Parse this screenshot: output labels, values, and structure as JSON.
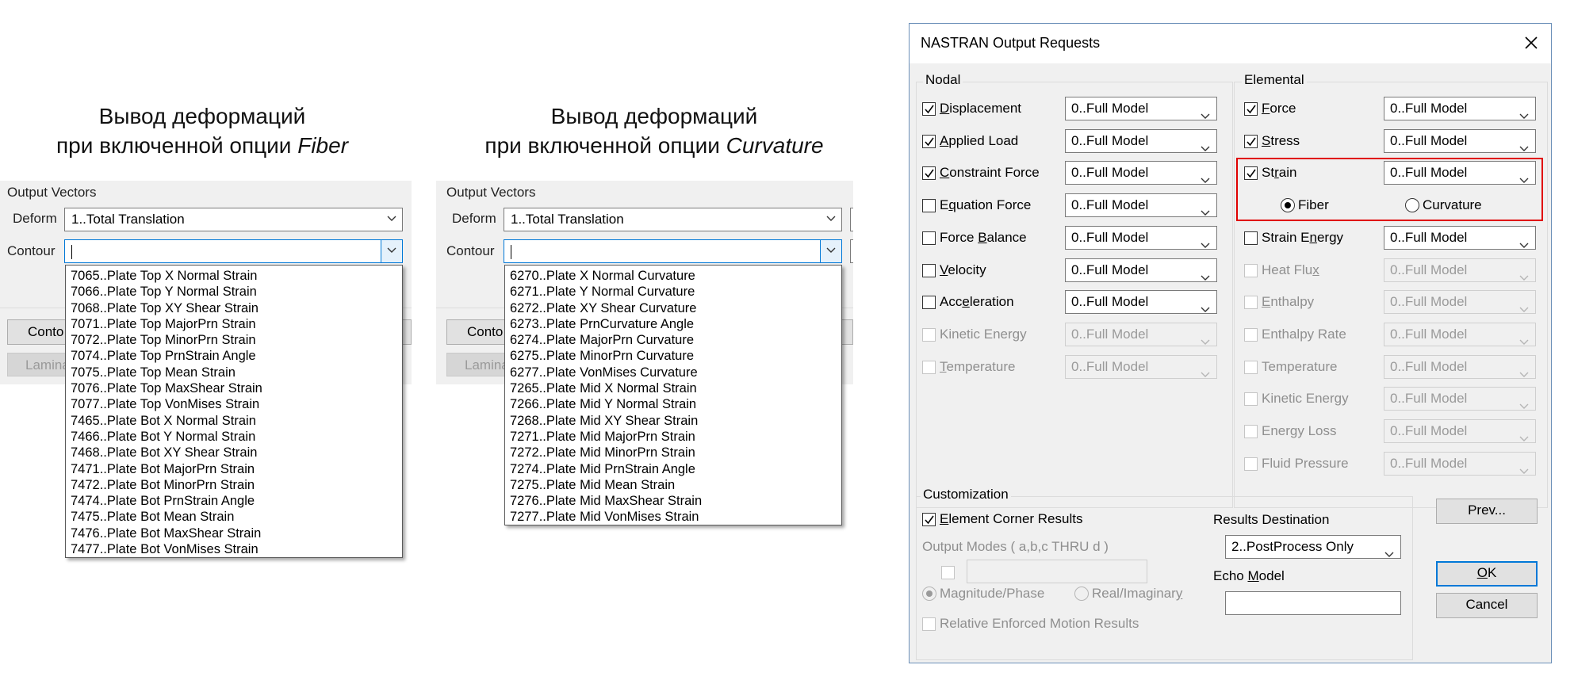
{
  "captions": {
    "fiber": {
      "line1": "Вывод деформаций",
      "line2_prefix": "при включенной опции ",
      "line2_em": "Fiber"
    },
    "curvature": {
      "line1": "Вывод деформаций",
      "line2_prefix": "при включенной опции ",
      "line2_em": "Curvature"
    }
  },
  "left_panel": {
    "group_label": "Output Vectors",
    "deform_label": "Deform",
    "deform_value": "1..Total Translation",
    "contour_label": "Contour",
    "contour_value": "",
    "contour_button": "Conto",
    "laminate_button": "Lamina",
    "list": [
      "7065..Plate Top X Normal Strain",
      "7066..Plate Top Y Normal Strain",
      "7068..Plate Top XY Shear Strain",
      "7071..Plate Top MajorPrn Strain",
      "7072..Plate Top MinorPrn Strain",
      "7074..Plate Top PrnStrain Angle",
      "7075..Plate Top Mean Strain",
      "7076..Plate Top MaxShear Strain",
      "7077..Plate Top VonMises Strain",
      "7465..Plate Bot X Normal Strain",
      "7466..Plate Bot Y Normal Strain",
      "7468..Plate Bot XY Shear Strain",
      "7471..Plate Bot MajorPrn Strain",
      "7472..Plate Bot MinorPrn Strain",
      "7474..Plate Bot PrnStrain Angle",
      "7475..Plate Bot Mean Strain",
      "7476..Plate Bot MaxShear Strain",
      "7477..Plate Bot VonMises Strain"
    ]
  },
  "middle_panel": {
    "group_label": "Output Vectors",
    "deform_label": "Deform",
    "deform_value": "1..Total Translation",
    "contour_label": "Contour",
    "contour_value": "",
    "contour_button": "Conto",
    "laminate_button": "Lamina",
    "list": [
      "6270..Plate X Normal Curvature",
      "6271..Plate Y Normal Curvature",
      "6272..Plate XY Shear Curvature",
      "6273..Plate PrnCurvature Angle",
      "6274..Plate MajorPrn Curvature",
      "6275..Plate MinorPrn Curvature",
      "6277..Plate VonMises Curvature",
      "7265..Plate Mid X Normal Strain",
      "7266..Plate Mid Y Normal Strain",
      "7268..Plate Mid XY Shear Strain",
      "7271..Plate Mid MajorPrn Strain",
      "7272..Plate Mid MinorPrn Strain",
      "7274..Plate Mid PrnStrain Angle",
      "7275..Plate Mid Mean Strain",
      "7276..Plate Mid MaxShear Strain",
      "7277..Plate Mid VonMises Strain"
    ]
  },
  "dialog": {
    "title": "NASTRAN Output Requests",
    "close_glyph": "✕",
    "nodal": {
      "label": "Nodal",
      "rows": [
        {
          "pre": "",
          "ul": "D",
          "post": "isplacement",
          "checked": true,
          "enabled": true,
          "value": "0..Full Model"
        },
        {
          "pre": "",
          "ul": "A",
          "post": "pplied Load",
          "checked": true,
          "enabled": true,
          "value": "0..Full Model"
        },
        {
          "pre": "",
          "ul": "C",
          "post": "onstraint Force",
          "checked": true,
          "enabled": true,
          "value": "0..Full Model"
        },
        {
          "pre": "E",
          "ul": "q",
          "post": "uation Force",
          "checked": false,
          "enabled": true,
          "value": "0..Full Model"
        },
        {
          "pre": "Force ",
          "ul": "B",
          "post": "alance",
          "checked": false,
          "enabled": true,
          "value": "0..Full Model"
        },
        {
          "pre": "",
          "ul": "V",
          "post": "elocity",
          "checked": false,
          "enabled": true,
          "value": "0..Full Model"
        },
        {
          "pre": "Acc",
          "ul": "e",
          "post": "leration",
          "checked": false,
          "enabled": true,
          "value": "0..Full Model"
        },
        {
          "pre": "Kinetic Energy",
          "ul": "",
          "post": "",
          "checked": false,
          "enabled": false,
          "value": "0..Full Model"
        },
        {
          "pre": "",
          "ul": "T",
          "post": "emperature",
          "checked": false,
          "enabled": false,
          "value": "0..Full Model"
        }
      ]
    },
    "elemental": {
      "label": "Elemental",
      "rows": [
        {
          "pre": "",
          "ul": "F",
          "post": "orce",
          "checked": true,
          "enabled": true,
          "value": "0..Full Model"
        },
        {
          "pre": "",
          "ul": "S",
          "post": "tress",
          "checked": true,
          "enabled": true,
          "value": "0..Full Model"
        },
        {
          "pre": "St",
          "ul": "r",
          "post": "ain",
          "checked": true,
          "enabled": true,
          "value": "0..Full Model"
        },
        {
          "pre": "Strain E",
          "ul": "n",
          "post": "ergy",
          "checked": false,
          "enabled": true,
          "value": "0..Full Model"
        },
        {
          "pre": "Heat Flu",
          "ul": "x",
          "post": "",
          "checked": false,
          "enabled": false,
          "value": "0..Full Model"
        },
        {
          "pre": "",
          "ul": "E",
          "post": "nthalpy",
          "checked": false,
          "enabled": false,
          "value": "0..Full Model"
        },
        {
          "pre": "Enthalpy Rate",
          "ul": "",
          "post": "",
          "checked": false,
          "enabled": false,
          "value": "0..Full Model"
        },
        {
          "pre": "Temperature",
          "ul": "",
          "post": "",
          "checked": false,
          "enabled": false,
          "value": "0..Full Model"
        },
        {
          "pre": "Kinetic Energy",
          "ul": "",
          "post": "",
          "checked": false,
          "enabled": false,
          "value": "0..Full Model"
        },
        {
          "pre": "Energy Loss",
          "ul": "",
          "post": "",
          "checked": false,
          "enabled": false,
          "value": "0..Full Model"
        },
        {
          "pre": "Fluid Pressure",
          "ul": "",
          "post": "",
          "checked": false,
          "enabled": false,
          "value": "0..Full Model"
        }
      ],
      "strain_options": {
        "fiber": "Fiber",
        "curvature": "Curvature",
        "selected": "fiber"
      },
      "highlight_color": "#e00000"
    },
    "customization": {
      "label": "Customization",
      "element_corner": {
        "pre": "",
        "ul": "E",
        "post": "lement Corner Results",
        "checked": true
      },
      "output_modes_label": "Output Modes ( a,b,c THRU d )",
      "output_modes_value": "",
      "magnitude_phase": {
        "pre": "Ma",
        "ul": "g",
        "post": "nitude/Phase"
      },
      "real_imaginary": {
        "pre": "Real/Imaginar",
        "ul": "y",
        "post": ""
      },
      "relative_enforced": "Relative Enforced Motion Results",
      "results_destination_label": "Results Destination",
      "results_destination_value": "2..PostProcess Only",
      "echo_model": {
        "pre": "Echo ",
        "ul": "M",
        "post": "odel"
      },
      "echo_model_value": ""
    },
    "buttons": {
      "prev": "Prev...",
      "ok": {
        "pre": "",
        "ul": "O",
        "post": "K"
      },
      "cancel": "Cancel"
    }
  }
}
